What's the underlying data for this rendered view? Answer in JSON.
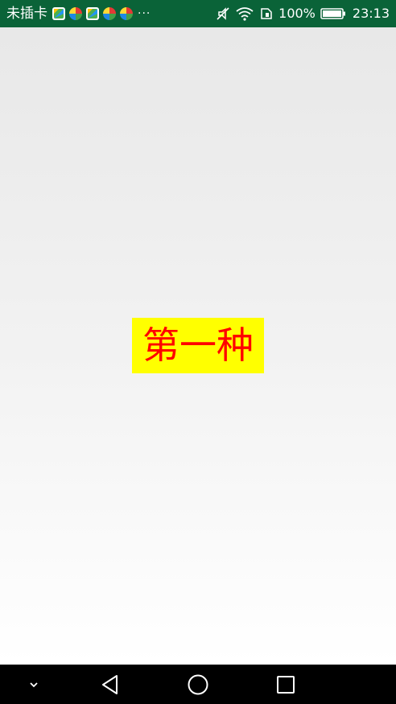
{
  "status_bar": {
    "carrier": "未插卡",
    "notification_icons": [
      "app-square-icon",
      "app-pinwheel-icon",
      "app-square-icon",
      "app-pinwheel-icon",
      "app-pinwheel-icon"
    ],
    "more_indicator": "···",
    "battery_percent": "100%",
    "time": "23:13",
    "background_color": "#0a6338"
  },
  "main": {
    "label": "第一种",
    "label_text_color": "#ff0000",
    "label_background_color": "#ffff00"
  },
  "nav_bar": {
    "buttons": [
      "hide-keyboard",
      "back",
      "home",
      "recents"
    ]
  }
}
